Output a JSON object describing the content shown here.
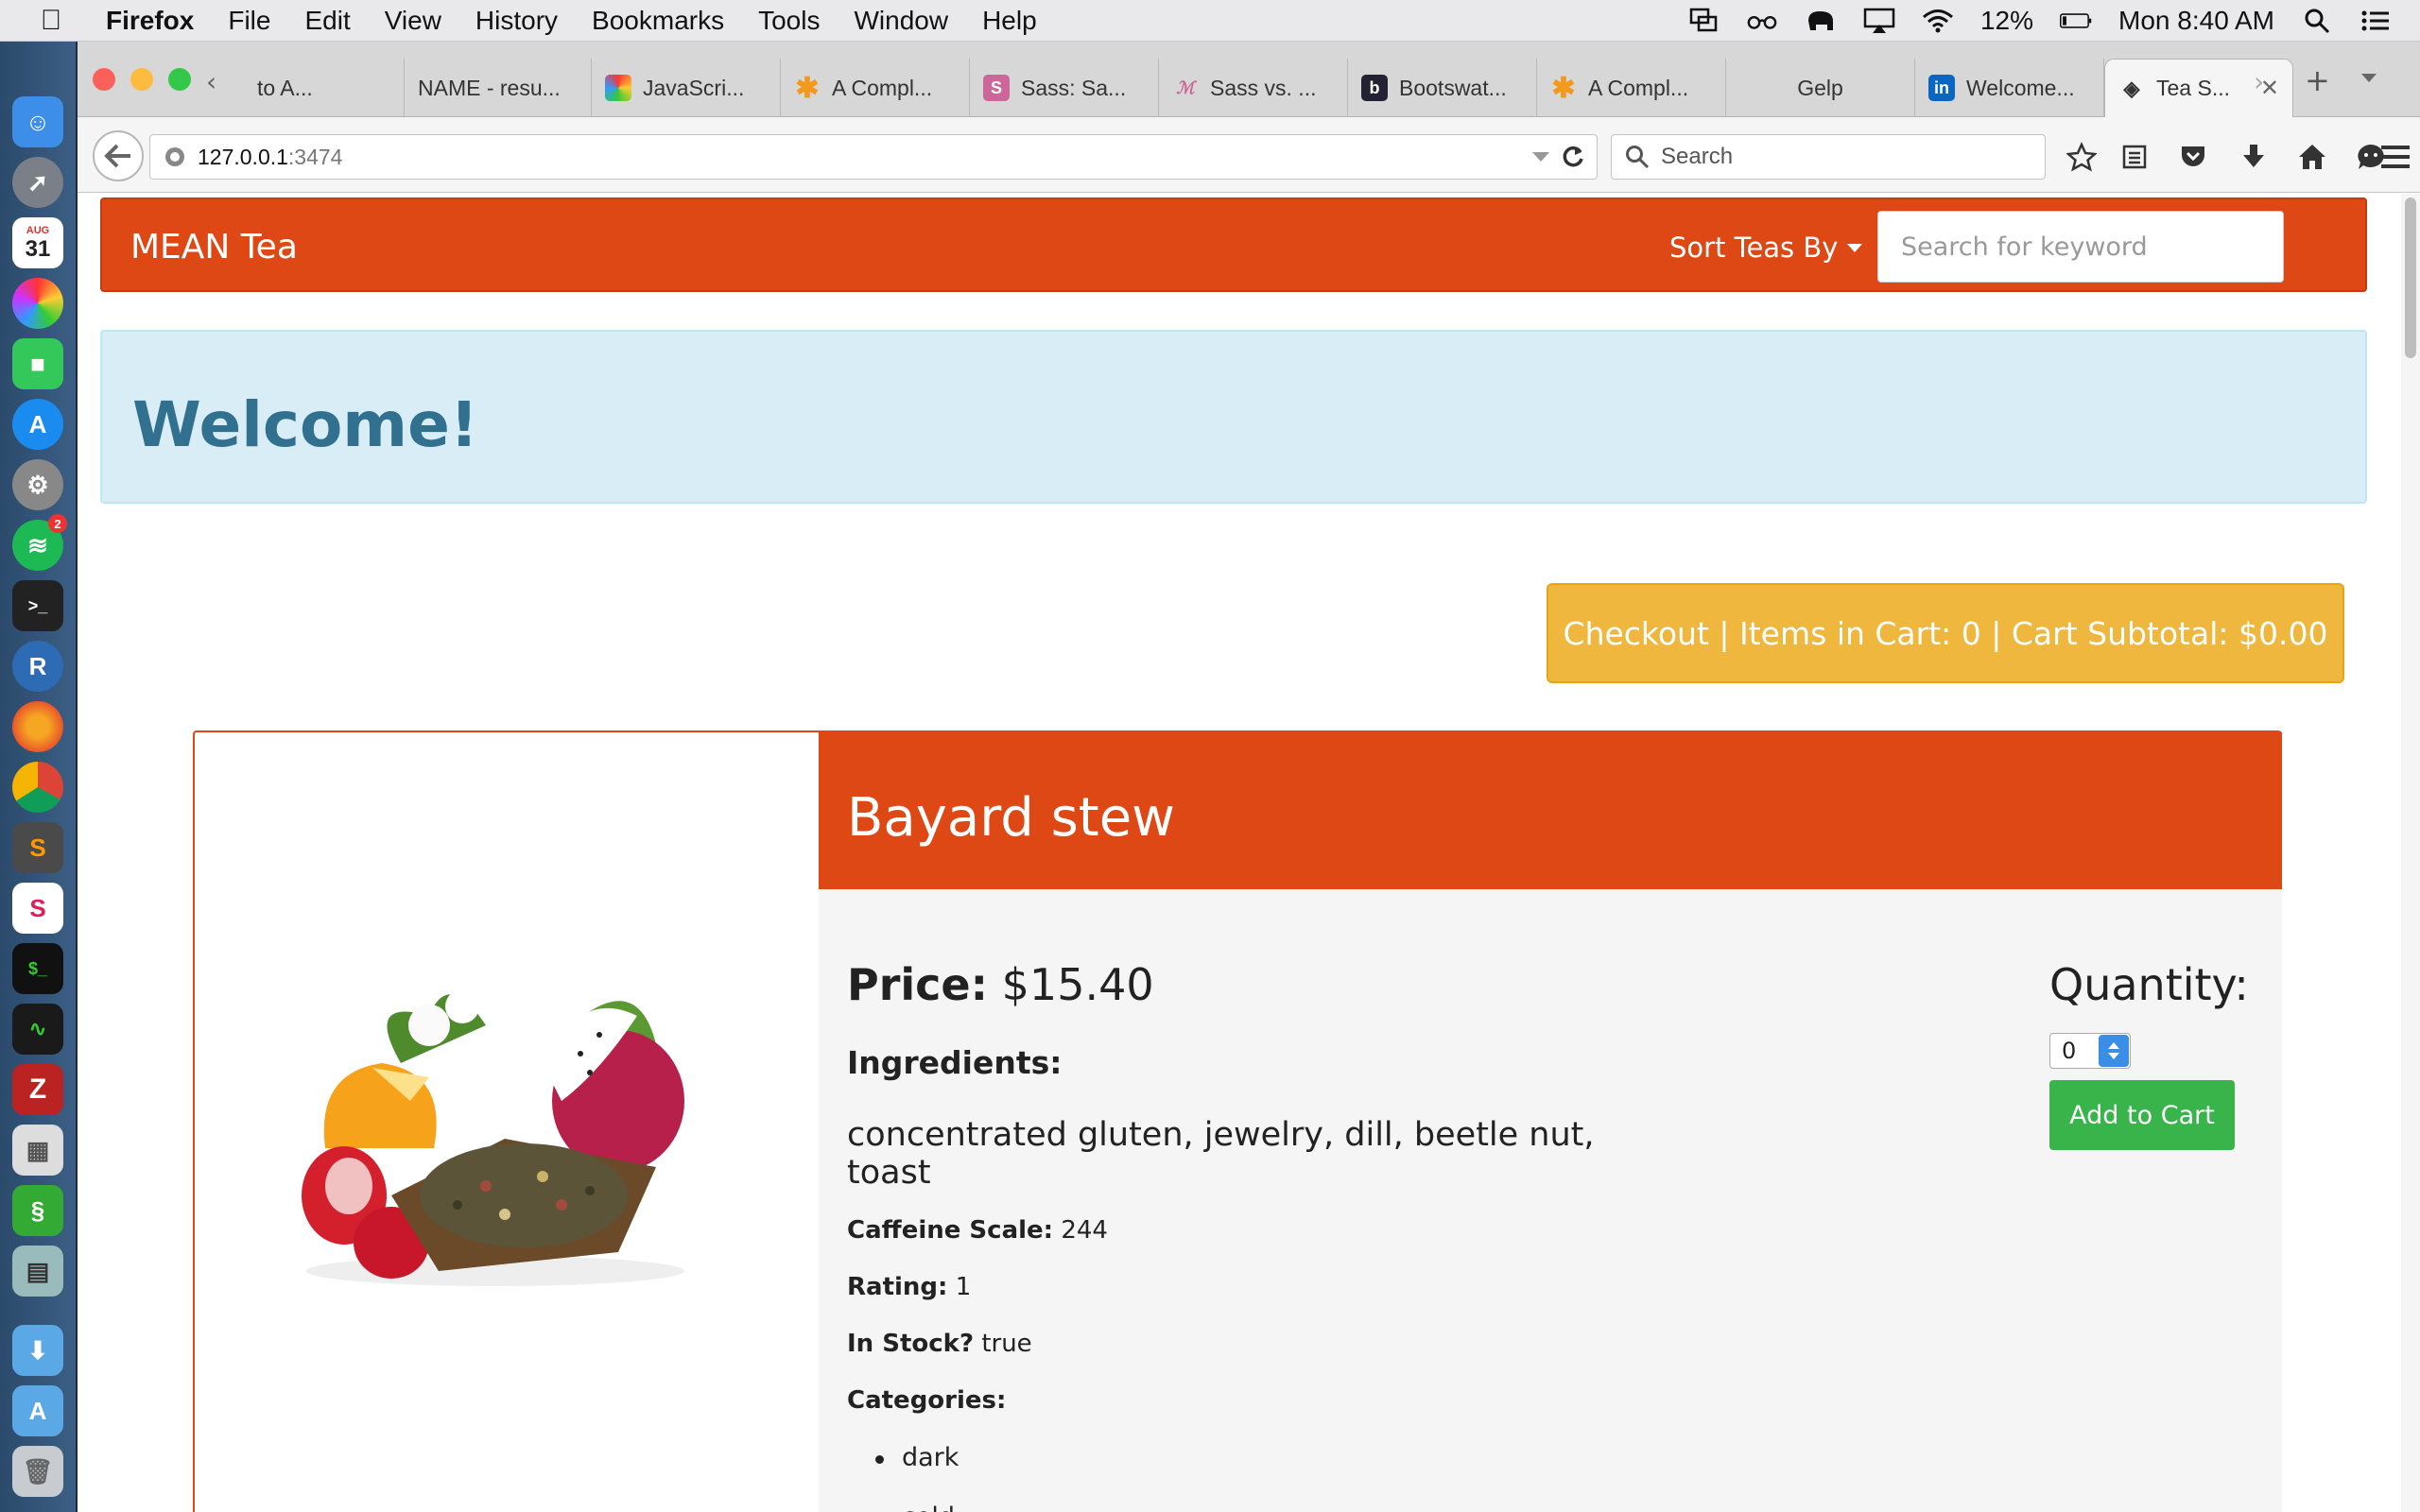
{
  "menubar": {
    "app_name": "Firefox",
    "items": [
      "File",
      "Edit",
      "View",
      "History",
      "Bookmarks",
      "Tools",
      "Window",
      "Help"
    ],
    "battery": "12%",
    "clock": "Mon 8:40 AM"
  },
  "dock": {
    "calendar_month": "AUG",
    "calendar_day": "31",
    "spotify_badge": "2"
  },
  "tabs": [
    {
      "title": "to A...",
      "icon": "partial-tab"
    },
    {
      "title": "NAME - resu...",
      "icon": "blank-page-icon"
    },
    {
      "title": "JavaScri...",
      "icon": "colorful-icon"
    },
    {
      "title": "A Compl...",
      "icon": "asterisk-icon"
    },
    {
      "title": "Sass: Sa...",
      "icon": "sass-icon"
    },
    {
      "title": "Sass vs. ...",
      "icon": "sass-script-icon"
    },
    {
      "title": "Bootswat...",
      "icon": "bootswatch-icon"
    },
    {
      "title": "A Compl...",
      "icon": "asterisk-icon"
    },
    {
      "title": "Gelp",
      "icon": "none"
    },
    {
      "title": "Welcome...",
      "icon": "linkedin-icon"
    },
    {
      "title": "Tea S...",
      "icon": "code-icon"
    }
  ],
  "toolbar": {
    "url_host": "127.0.0.1",
    "url_port": ":3474",
    "search_placeholder": "Search"
  },
  "site": {
    "brand": "MEAN Tea",
    "sort_label": "Sort Teas By",
    "keyword_placeholder": "Search for keyword",
    "welcome": "Welcome!",
    "checkout": "Checkout | Items in Cart: 0 | Cart Subtotal: $0.00"
  },
  "product": {
    "name": "Bayard stew",
    "price_label": "Price:",
    "price": "$15.40",
    "ingredients_label": "Ingredients:",
    "ingredients": "concentrated gluten, jewelry, dill, beetle nut, toast",
    "caffeine_label": "Caffeine Scale:",
    "caffeine": "244",
    "rating_label": "Rating:",
    "rating": "1",
    "stock_label": "In Stock?",
    "stock": "true",
    "categories_label": "Categories:",
    "categories": [
      "dark",
      "cold"
    ],
    "quantity_label": "Quantity:",
    "quantity": "0",
    "add_label": "Add to Cart"
  },
  "colors": {
    "brand": "#dd4814",
    "checkout": "#efb73e",
    "add_to_cart": "#38b44a",
    "welcome_text": "#31708f"
  }
}
